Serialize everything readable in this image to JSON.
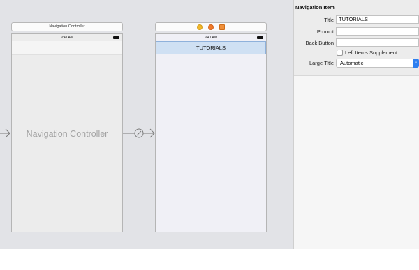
{
  "canvas": {
    "nav_scene": {
      "title": "Navigation Controller",
      "status_time": "9:41 AM",
      "label": "Navigation Controller"
    },
    "tutorials_scene": {
      "status_time": "9:41 AM",
      "nav_title": "TUTORIALS",
      "bar_icons": [
        "view-controller-icon",
        "first-responder-icon",
        "exit-icon"
      ]
    }
  },
  "inspector": {
    "section_title": "Navigation Item",
    "title_label": "Title",
    "title_value": "TUTORIALS",
    "prompt_label": "Prompt",
    "prompt_value": "",
    "back_button_label": "Back Button",
    "back_button_value": "",
    "left_items_supplement_label": "Left Items Supplement",
    "left_items_supplement_checked": false,
    "large_title_label": "Large Title",
    "large_title_value": "Automatic"
  },
  "colors": {
    "canvas_bg": "#e2e3e7",
    "navbar_selected": "#cfe0f3",
    "accent": "#2f7ff0"
  }
}
